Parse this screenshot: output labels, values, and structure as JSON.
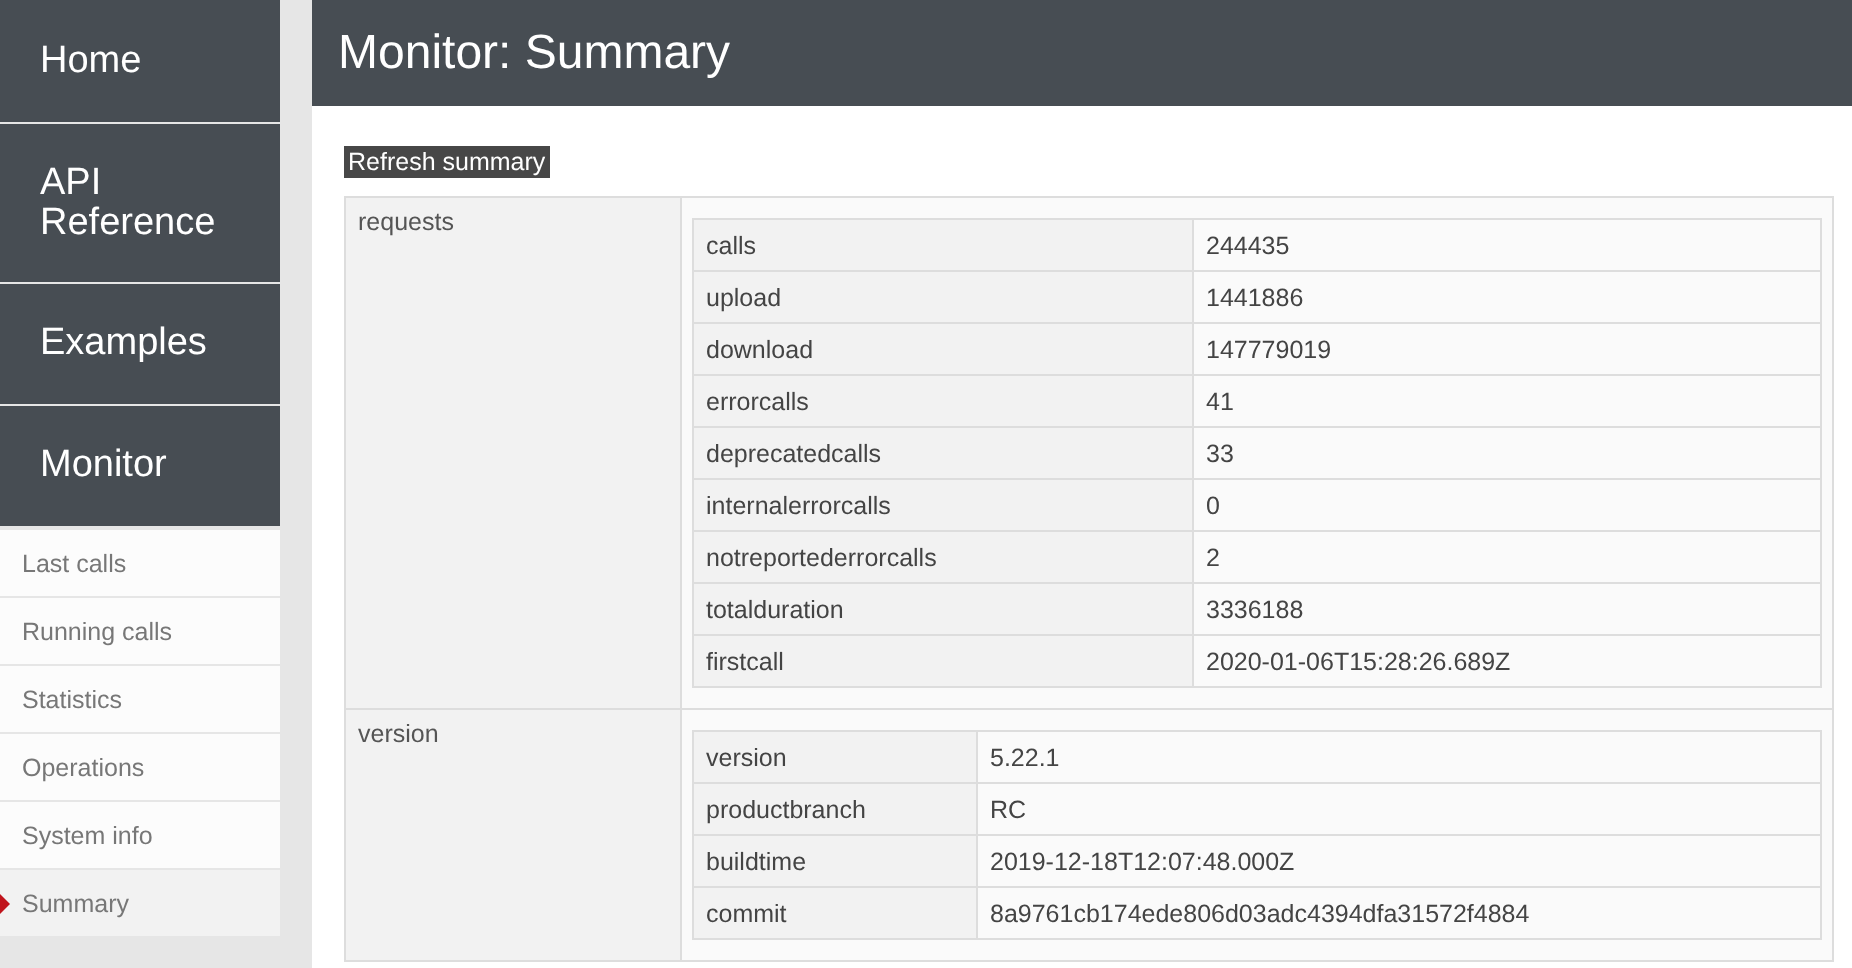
{
  "nav": [
    {
      "label": "Home",
      "selected": false
    },
    {
      "label": "API Reference",
      "selected": false
    },
    {
      "label": "Examples",
      "selected": false
    },
    {
      "label": "Monitor",
      "selected": false
    }
  ],
  "subnav": [
    {
      "label": "Last calls",
      "selected": false
    },
    {
      "label": "Running calls",
      "selected": false
    },
    {
      "label": "Statistics",
      "selected": false
    },
    {
      "label": "Operations",
      "selected": false
    },
    {
      "label": "System info",
      "selected": false
    },
    {
      "label": "Summary",
      "selected": true
    }
  ],
  "header": {
    "title": "Monitor: Summary"
  },
  "refresh_button": "Refresh summary",
  "sections": [
    {
      "name": "requests",
      "rows": [
        [
          "calls",
          "244435"
        ],
        [
          "upload",
          "1441886"
        ],
        [
          "download",
          "147779019"
        ],
        [
          "errorcalls",
          "41"
        ],
        [
          "deprecatedcalls",
          "33"
        ],
        [
          "internalerrorcalls",
          "0"
        ],
        [
          "notreportederrorcalls",
          "2"
        ],
        [
          "totalduration",
          "3336188"
        ],
        [
          "firstcall",
          "2020-01-06T15:28:26.689Z"
        ]
      ]
    },
    {
      "name": "version",
      "rows": [
        [
          "version",
          "5.22.1"
        ],
        [
          "productbranch",
          "RC"
        ],
        [
          "buildtime",
          "2019-12-18T12:07:48.000Z"
        ],
        [
          "commit",
          "8a9761cb174ede806d03adc4394dfa31572f4884"
        ]
      ]
    }
  ]
}
